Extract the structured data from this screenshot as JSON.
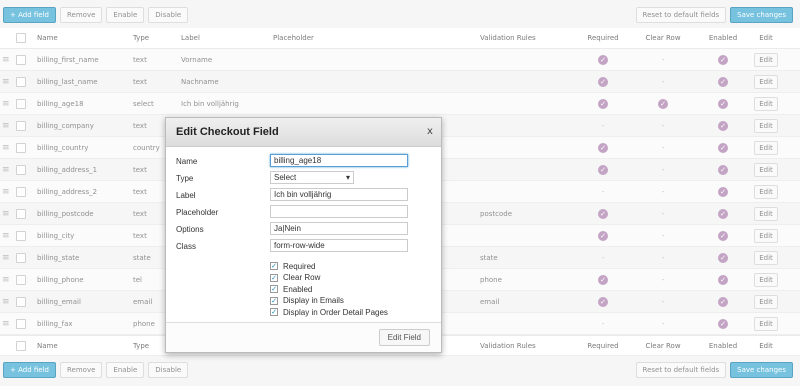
{
  "toolbar": {
    "add_field": "+ Add field",
    "remove": "Remove",
    "enable": "Enable",
    "disable": "Disable",
    "reset": "Reset to default fields",
    "save": "Save changes"
  },
  "columns": {
    "name": "Name",
    "type": "Type",
    "label": "Label",
    "placeholder": "Placeholder",
    "validation": "Validation Rules",
    "required": "Required",
    "clear_row": "Clear Row",
    "enabled": "Enabled",
    "edit": "Edit"
  },
  "rows": [
    {
      "name": "billing_first_name",
      "type": "text",
      "label": "Vorname",
      "placeholder": "",
      "validation": "",
      "required": true,
      "clear_row": false,
      "enabled": true
    },
    {
      "name": "billing_last_name",
      "type": "text",
      "label": "Nachname",
      "placeholder": "",
      "validation": "",
      "required": true,
      "clear_row": false,
      "enabled": true
    },
    {
      "name": "billing_age18",
      "type": "select",
      "label": "Ich bin volljährig",
      "placeholder": "",
      "validation": "",
      "required": true,
      "clear_row": true,
      "enabled": true
    },
    {
      "name": "billing_company",
      "type": "text",
      "label": "",
      "placeholder": "",
      "validation": "",
      "required": false,
      "clear_row": false,
      "enabled": true
    },
    {
      "name": "billing_country",
      "type": "country",
      "label": "",
      "placeholder": "",
      "validation": "",
      "required": true,
      "clear_row": false,
      "enabled": true
    },
    {
      "name": "billing_address_1",
      "type": "text",
      "label": "",
      "placeholder": "",
      "validation": "",
      "required": true,
      "clear_row": false,
      "enabled": true
    },
    {
      "name": "billing_address_2",
      "type": "text",
      "label": "",
      "placeholder": "",
      "validation": "",
      "required": false,
      "clear_row": false,
      "enabled": true
    },
    {
      "name": "billing_postcode",
      "type": "text",
      "label": "",
      "placeholder": "",
      "validation": "postcode",
      "required": true,
      "clear_row": false,
      "enabled": true
    },
    {
      "name": "billing_city",
      "type": "text",
      "label": "",
      "placeholder": "",
      "validation": "",
      "required": true,
      "clear_row": false,
      "enabled": true
    },
    {
      "name": "billing_state",
      "type": "state",
      "label": "",
      "placeholder": "",
      "validation": "state",
      "required": false,
      "clear_row": false,
      "enabled": true
    },
    {
      "name": "billing_phone",
      "type": "tel",
      "label": "",
      "placeholder": "",
      "validation": "phone",
      "required": true,
      "clear_row": false,
      "enabled": true
    },
    {
      "name": "billing_email",
      "type": "email",
      "label": "",
      "placeholder": "",
      "validation": "email",
      "required": true,
      "clear_row": false,
      "enabled": true
    },
    {
      "name": "billing_fax",
      "type": "phone",
      "label": "",
      "placeholder": "",
      "validation": "",
      "required": false,
      "clear_row": false,
      "enabled": true
    }
  ],
  "dash": "-",
  "edit_label": "Edit",
  "modal": {
    "title": "Edit Checkout Field",
    "close": "x",
    "labels": {
      "name": "Name",
      "type": "Type",
      "label": "Label",
      "placeholder": "Placeholder",
      "options": "Options",
      "class": "Class"
    },
    "values": {
      "name": "billing_age18",
      "type": "Select",
      "label": "Ich bin volljährig",
      "placeholder": "",
      "options": "Ja|Nein",
      "class": "form-row-wide"
    },
    "checkboxes": [
      {
        "label": "Required",
        "checked": true
      },
      {
        "label": "Clear Row",
        "checked": true
      },
      {
        "label": "Enabled",
        "checked": true
      },
      {
        "label": "Display in Emails",
        "checked": true
      },
      {
        "label": "Display in Order Detail Pages",
        "checked": true
      }
    ],
    "submit": "Edit Field"
  }
}
